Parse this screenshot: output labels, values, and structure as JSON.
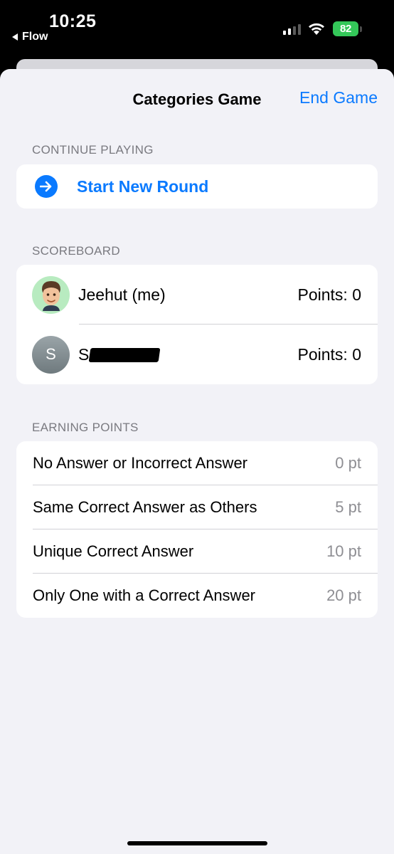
{
  "status_bar": {
    "time": "10:25",
    "back_app": "Flow",
    "battery": "82"
  },
  "nav": {
    "title": "Categories Game",
    "end_label": "End Game"
  },
  "continue_section": {
    "header": "CONTINUE PLAYING",
    "start_label": "Start New Round"
  },
  "scoreboard": {
    "header": "SCOREBOARD",
    "players": [
      {
        "name": "Jeehut (me)",
        "points": "Points: 0"
      },
      {
        "initial": "S",
        "name": "S",
        "points": "Points: 0"
      }
    ]
  },
  "earning": {
    "header": "EARNING POINTS",
    "rules": [
      {
        "label": "No Answer or Incorrect Answer",
        "points": "0 pt"
      },
      {
        "label": "Same Correct Answer as Others",
        "points": "5 pt"
      },
      {
        "label": "Unique Correct Answer",
        "points": "10 pt"
      },
      {
        "label": "Only One with a Correct Answer",
        "points": "20 pt"
      }
    ]
  },
  "colors": {
    "accent": "#0a7aff",
    "background": "#f2f2f7",
    "battery": "#34c759"
  }
}
